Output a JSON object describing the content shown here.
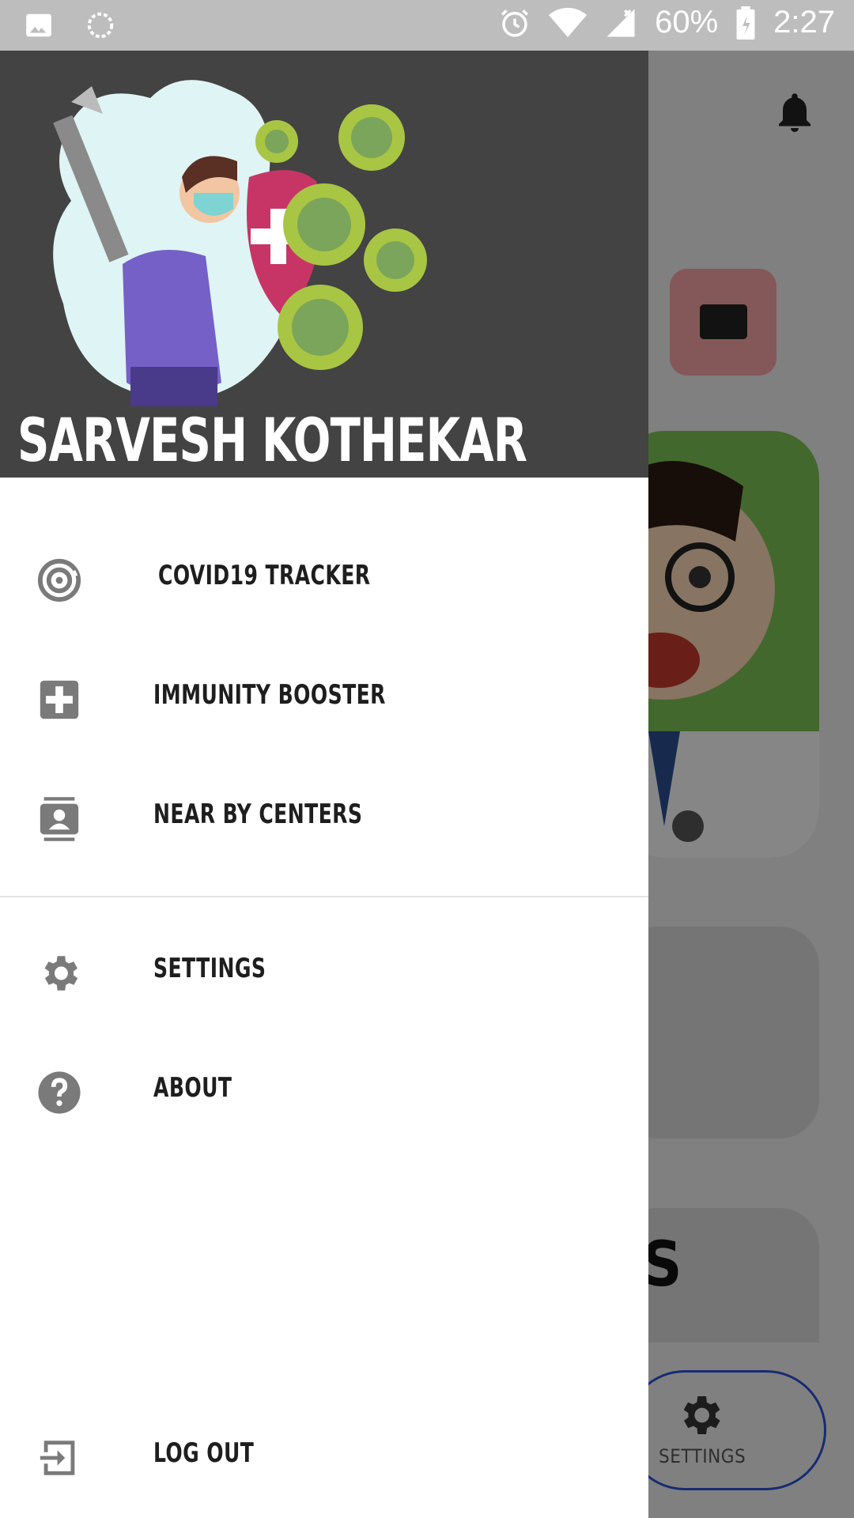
{
  "status_bar": {
    "battery_percent": "60%",
    "time": "2:27",
    "icons": [
      "gallery-icon",
      "loading-icon",
      "alarm-icon",
      "wifi-icon",
      "signal-icon",
      "battery-icon"
    ]
  },
  "drawer": {
    "user_name": "SARVESH KOTHEKAR",
    "menu": [
      {
        "label": "COVID19 TRACKER",
        "icon": "radar-icon"
      },
      {
        "label": "IMMUNITY BOOSTER",
        "icon": "medical-plus-icon"
      },
      {
        "label": "NEAR BY CENTERS",
        "icon": "contact-card-icon"
      },
      {
        "label": "SETTINGS",
        "icon": "gear-icon"
      },
      {
        "label": "ABOUT",
        "icon": "help-icon"
      }
    ],
    "logout_label": "LOG OUT"
  },
  "background": {
    "partial_letter": "S",
    "nav_settings_label": "SETTINGS"
  },
  "colors": {
    "drawer_header_bg": "#434343",
    "icon_grey": "#7a7a7a",
    "nav_accent": "#2d4fd0"
  }
}
